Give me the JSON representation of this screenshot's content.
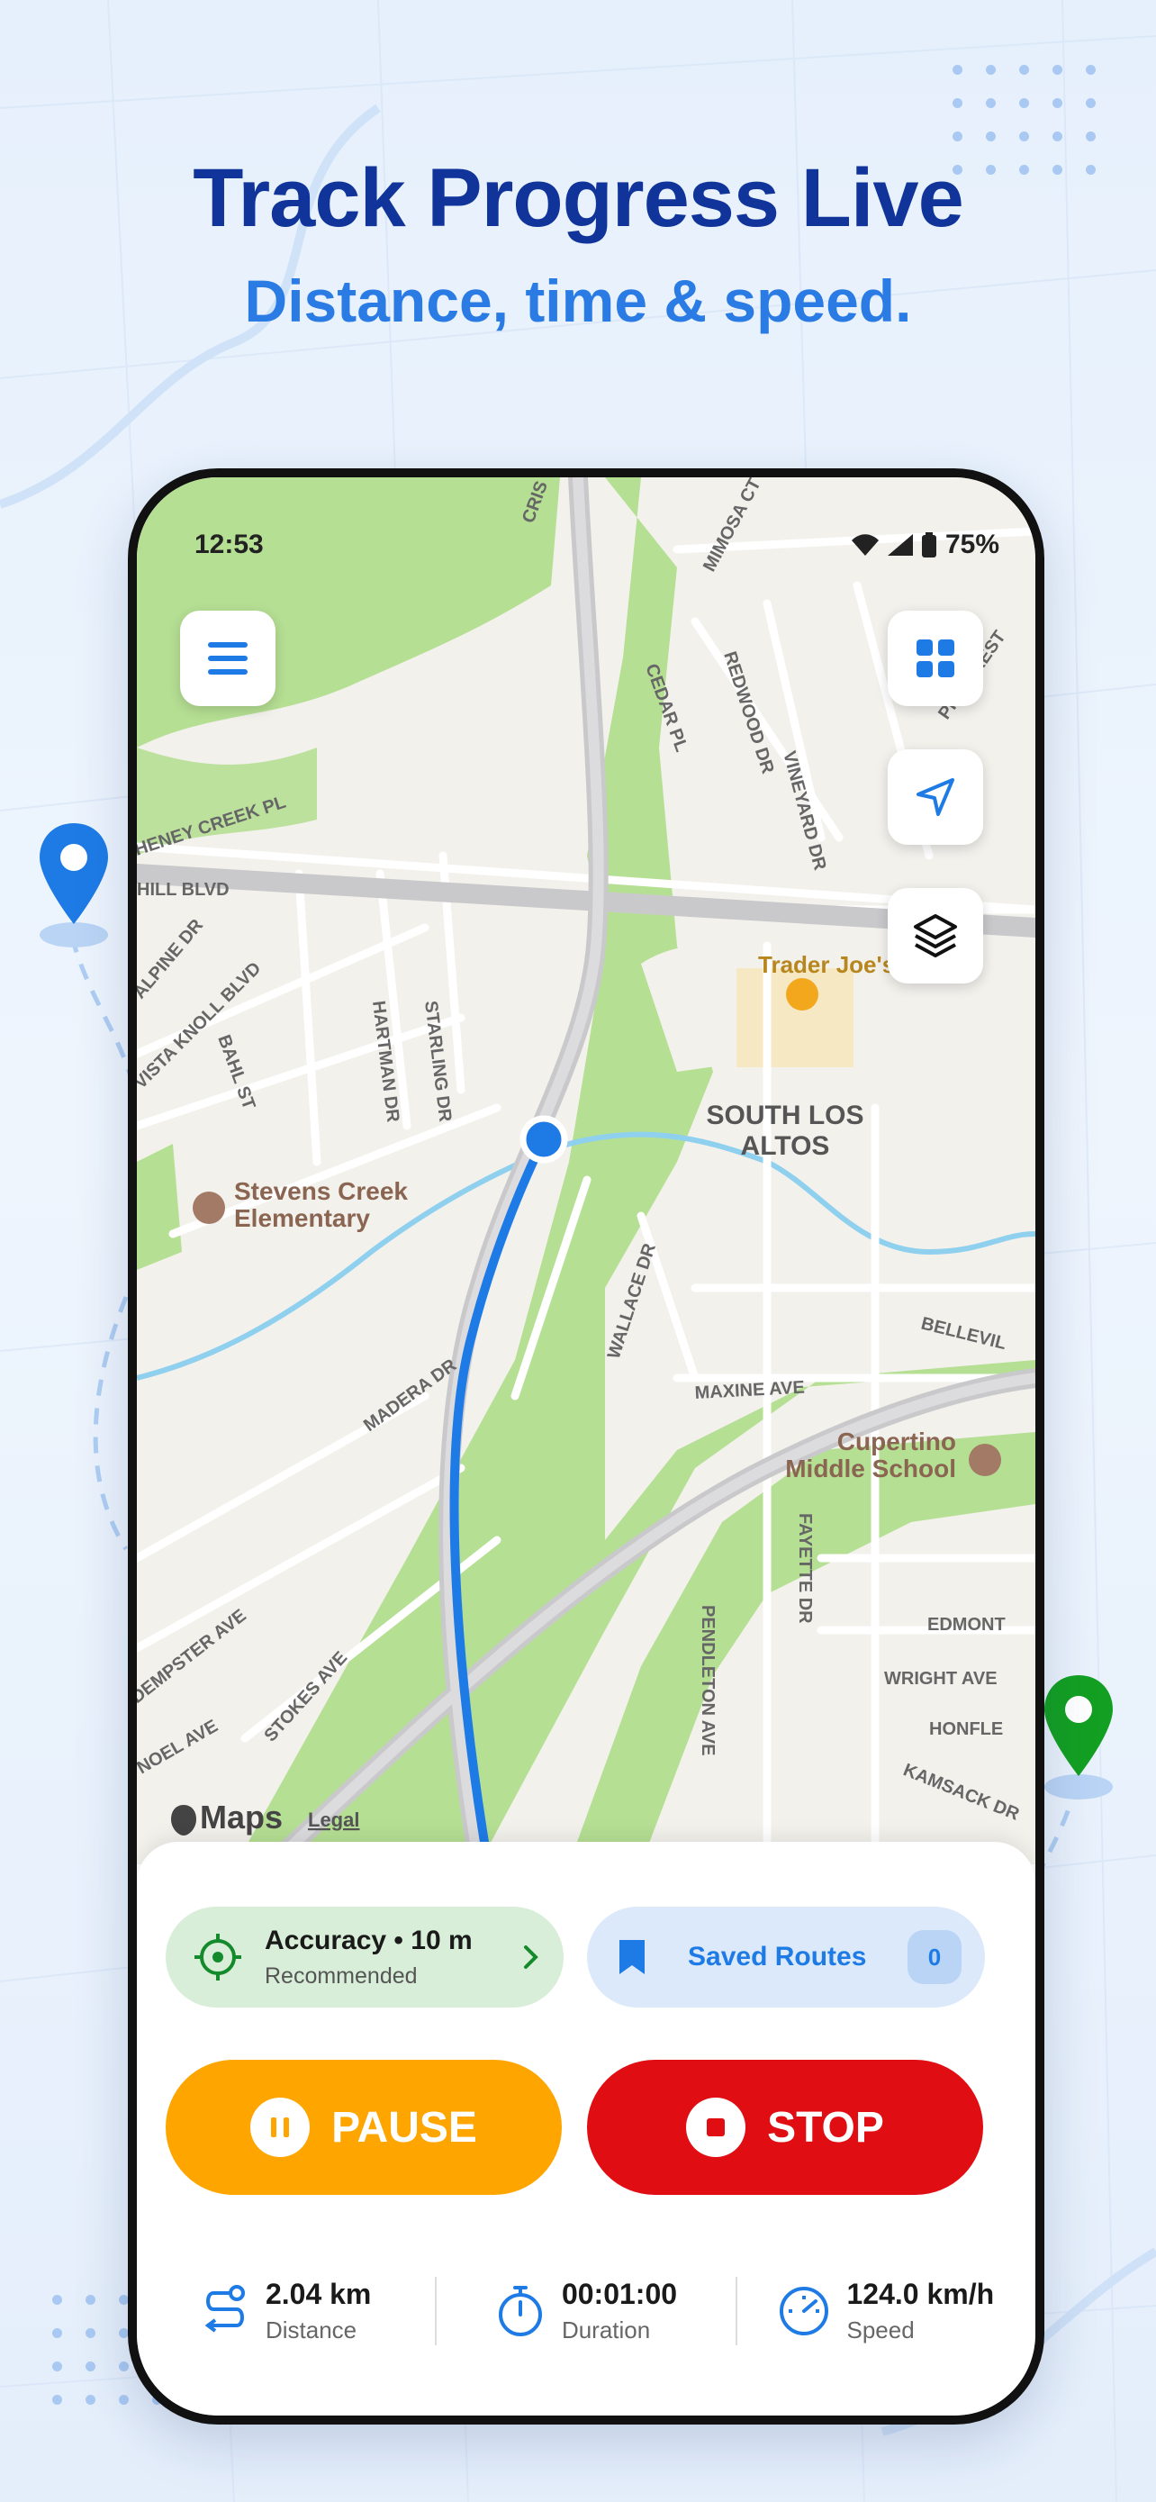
{
  "promo": {
    "headline": "Track Progress Live",
    "subheadline": "Distance, time & speed."
  },
  "status_bar": {
    "time": "12:53",
    "battery": "75%"
  },
  "map": {
    "streets": [
      "CRIS",
      "MIMOSA CT",
      "CEDAR PL",
      "REDWOOD DR",
      "VINEYARD DR",
      "PINECREST",
      "HENEY CREEK PL",
      "HILL BLVD",
      "ALPINE DR",
      "VISTA KNOLL BLVD",
      "BAHL ST",
      "HARTMAN DR",
      "STARLING DR",
      "WALLACE DR",
      "BELLEVIL",
      "MAXINE AVE",
      "MADERA DR",
      "FAYETTE DR",
      "PENDLETON AVE",
      "EDMONT",
      "WRIGHT AVE",
      "HONFLE",
      "KAMSACK DR",
      "DEMPSTER AVE",
      "STOKES AVE",
      "NOEL AVE"
    ],
    "places": {
      "trader_joes": "Trader Joe's",
      "south_los_altos_1": "SOUTH LOS",
      "south_los_altos_2": "ALTOS",
      "stevens_creek_1": "Stevens Creek",
      "stevens_creek_2": "Elementary",
      "cupertino_1": "Cupertino",
      "cupertino_2": "Middle School"
    },
    "attribution": {
      "brand": "Maps",
      "legal": "Legal"
    }
  },
  "sheet": {
    "accuracy": {
      "title": "Accuracy • 10 m",
      "subtitle": "Recommended"
    },
    "saved_routes": {
      "label": "Saved Routes",
      "count": "0"
    },
    "pause_label": "PAUSE",
    "stop_label": "STOP",
    "stats": [
      {
        "value": "2.04 km",
        "label": "Distance",
        "icon": "route-icon"
      },
      {
        "value": "00:01:00",
        "label": "Duration",
        "icon": "stopwatch-icon"
      },
      {
        "value": "124.0 km/h",
        "label": "Speed",
        "icon": "speedometer-icon"
      }
    ]
  },
  "colors": {
    "headline": "#11349a",
    "subheadline": "#2a7be4",
    "route": "#1e7be6",
    "pause": "#fea500",
    "stop": "#e00d12",
    "accuracy_bg": "#d8eed8",
    "saved_bg": "#dbe9fa"
  }
}
